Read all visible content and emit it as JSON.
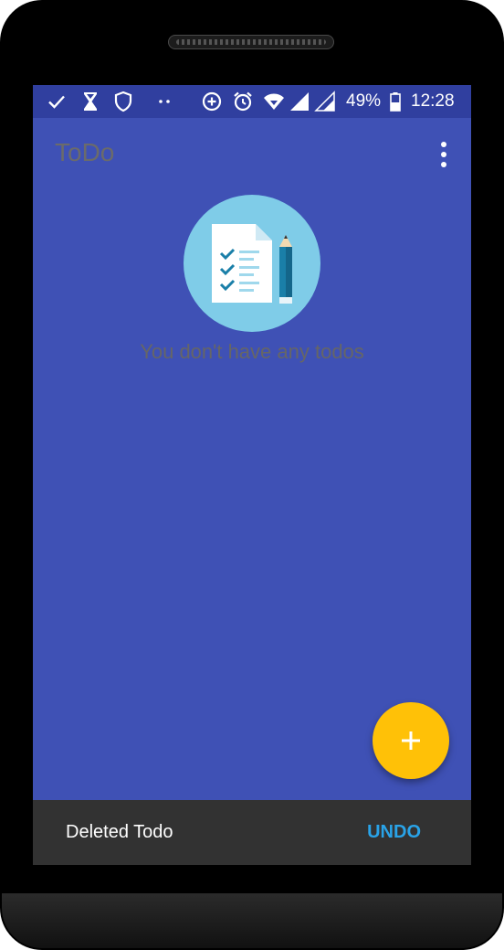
{
  "status_bar": {
    "icons_left": [
      "check-icon",
      "hourglass-icon",
      "shield-icon",
      "more-notifications-icon"
    ],
    "icons_right": [
      "data-saver-icon",
      "alarm-icon",
      "wifi-icon",
      "signal-icon",
      "signal-2-icon",
      "battery-icon"
    ],
    "battery": "49%",
    "time": "12:28"
  },
  "toolbar": {
    "title": "ToDo",
    "overflow_icon": "more-vert-icon"
  },
  "empty_state": {
    "illustration": "checklist-pencil-icon",
    "message": "You don't have any todos"
  },
  "fab": {
    "icon": "plus-icon"
  },
  "snackbar": {
    "message": "Deleted Todo",
    "action": "UNDO"
  },
  "colors": {
    "primary": "#3F51B5",
    "primary_dark": "#303F9F",
    "accent": "#FFC107",
    "snackbar_bg": "#323232",
    "snackbar_action": "#29A3E8"
  }
}
